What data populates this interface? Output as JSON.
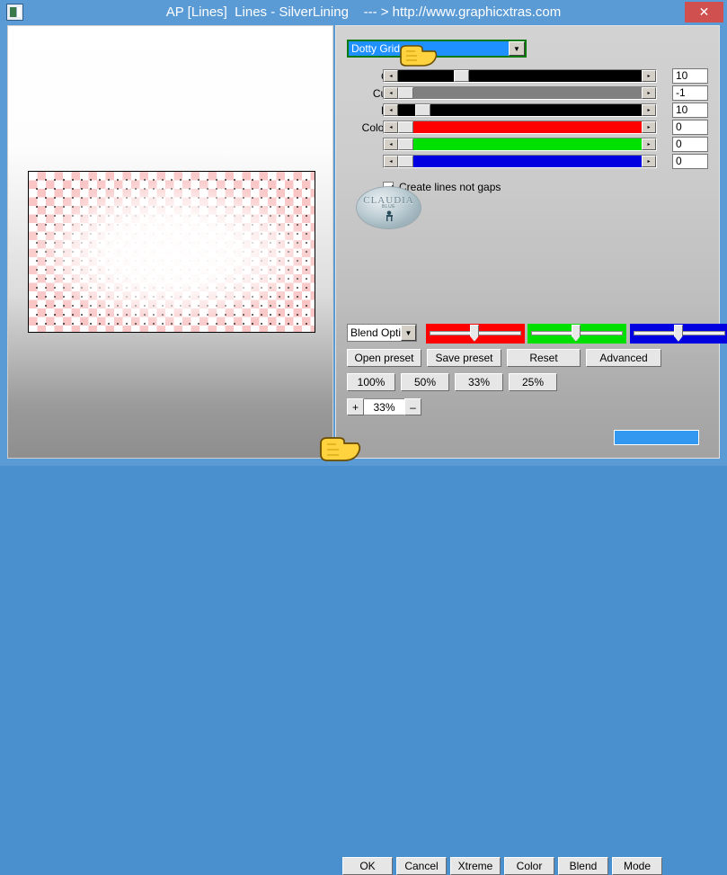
{
  "window": {
    "title": "AP [Lines]  Lines - SilverLining    --- > http://www.graphicxtras.com",
    "icon": "application-icon",
    "close_label": "✕"
  },
  "preset": {
    "selected": "Dotty Grid",
    "arrow": "▼"
  },
  "sliders": [
    {
      "label": "Gap:",
      "value": "10",
      "color": "#000000",
      "thumb_pct": 23,
      "dec": "◂",
      "inc": "▸"
    },
    {
      "label": "Cutoff:",
      "value": "-1",
      "color": "#808080",
      "thumb_pct": 0,
      "dec": "◂",
      "inc": "▸"
    },
    {
      "label": "Line:",
      "value": "10",
      "color": "#000000",
      "thumb_pct": 7,
      "dec": "◂",
      "inc": "▸"
    },
    {
      "label": "Color[R]:",
      "value": "0",
      "color": "#ff0000",
      "thumb_pct": 0,
      "dec": "◂",
      "inc": "▸"
    },
    {
      "label": "",
      "value": "0",
      "color": "#00e000",
      "thumb_pct": 0,
      "dec": "◂",
      "inc": "▸"
    },
    {
      "label": "",
      "value": "0",
      "color": "#0000e0",
      "thumb_pct": 0,
      "dec": "◂",
      "inc": "▸"
    }
  ],
  "checkbox": {
    "label": "Create lines not gaps",
    "checked": true
  },
  "badge": {
    "text": "CLAUDIA",
    "sub": "BLUE"
  },
  "blend": {
    "selected": "Blend Opti",
    "arrow": "▼"
  },
  "color_tracks": [
    {
      "name": "red",
      "color": "#ff0000",
      "thumb_pct": 49
    },
    {
      "name": "green",
      "color": "#00e000",
      "thumb_pct": 49
    },
    {
      "name": "blue",
      "color": "#0000e0",
      "thumb_pct": 49
    }
  ],
  "preset_buttons": [
    {
      "label": "Open preset"
    },
    {
      "label": "Save preset"
    },
    {
      "label": "Reset"
    },
    {
      "label": "Advanced"
    }
  ],
  "zoom_buttons": [
    {
      "label": "100%"
    },
    {
      "label": "50%"
    },
    {
      "label": "33%"
    },
    {
      "label": "25%"
    }
  ],
  "stepper": {
    "plus": "+",
    "value": "33%",
    "minus": "–"
  },
  "bottom_buttons": [
    {
      "label": "OK"
    },
    {
      "label": "Cancel"
    },
    {
      "label": "Xtreme"
    },
    {
      "label": "Color"
    },
    {
      "label": "Blend"
    },
    {
      "label": "Mode"
    }
  ],
  "colors": {
    "titlebar": "#5b9bd5",
    "close": "#d05050",
    "accent_blue": "#1e90ff",
    "status": "#3399f0",
    "combo_border": "#0a7a0a",
    "checker_pink": "#f9c5c5"
  }
}
